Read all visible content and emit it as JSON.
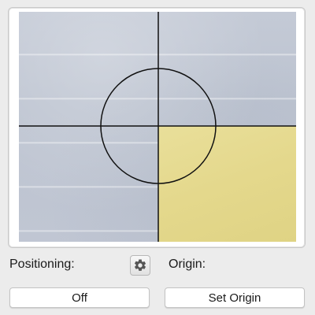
{
  "camera": {
    "reticle": "crosshair-with-circle"
  },
  "controls": {
    "positioning_label": "Positioning:",
    "positioning_icon": "gear-icon",
    "origin_label": "Origin:",
    "positioning_button": "Off",
    "origin_button": "Set Origin"
  },
  "colors": {
    "background": "#ececec",
    "reticle": "#111111",
    "paper": "#e4d88c",
    "wall": "#c0c6d3"
  }
}
